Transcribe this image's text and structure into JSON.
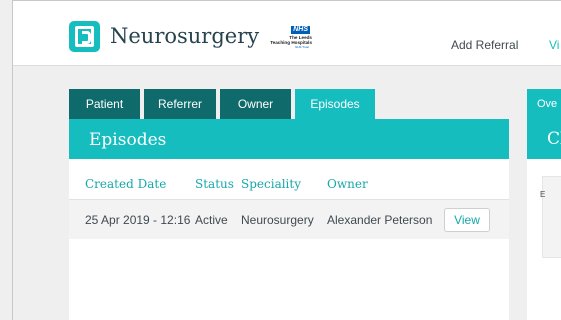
{
  "header": {
    "brand_name": "Neurosurgery",
    "nhs": {
      "badge": "NHS",
      "line1": "The Leeds",
      "line2": "Teaching Hospitals",
      "line3": "NHS Trust"
    },
    "nav": [
      {
        "label": "Add Referral"
      },
      {
        "label": "Vi"
      }
    ]
  },
  "tabs": [
    {
      "label": "Patient",
      "active": false
    },
    {
      "label": "Referrer",
      "active": false
    },
    {
      "label": "Owner",
      "active": false
    },
    {
      "label": "Episodes",
      "active": true
    }
  ],
  "episodes_panel": {
    "title": "Episodes",
    "columns": [
      "Created Date",
      "Status",
      "Speciality",
      "Owner"
    ],
    "rows": [
      {
        "created_date": "25 Apr 2019 - 12:16",
        "status": "Active",
        "speciality": "Neurosurgery",
        "owner": "Alexander Peterson",
        "action_label": "View"
      }
    ]
  },
  "right_panel": {
    "tab_label": "Ove",
    "title": "Cl",
    "card_text": "E"
  },
  "colors": {
    "accent": "#16bdbf",
    "tab_dark": "#0f6b6b",
    "header_text": "#27434e",
    "body_text": "#3f4a50",
    "nhs_blue": "#005eb8",
    "background": "#efefef"
  }
}
